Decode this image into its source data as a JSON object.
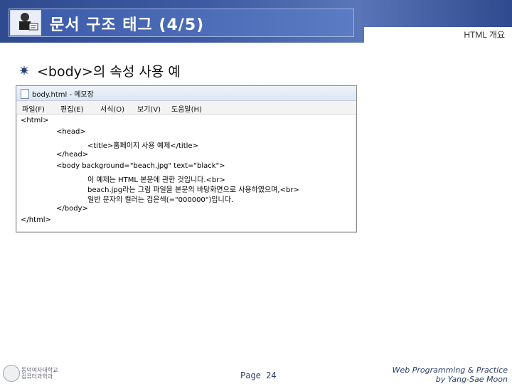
{
  "header": {
    "title": "문서 구조 태그 (4/5)",
    "section_label": "HTML 개요"
  },
  "bullet": {
    "text": "<body>의 속성 사용 예"
  },
  "notepad": {
    "window_title": "body.html - 메모장",
    "menu": [
      "파일(F)",
      "편집(E)",
      "서식(O)",
      "보기(V)",
      "도움말(H)"
    ],
    "lines": [
      "<html>",
      "<head>",
      "<title>홈페이지 사용 예제</title>",
      "</head>",
      "<body background=\"beach.jpg\" text=\"black\">",
      "이 예제는 HTML 본문에 관한 것입니다.<br>",
      "beach.jpg라는 그림 파일을 본문의 바탕화면으로 사용하였으며,<br>",
      "일반 문자의 컬러는 검은색(=\"000000\")입니다.",
      "</body>",
      "</html>"
    ]
  },
  "footer": {
    "logo_text_1": "동덕여자대학교",
    "logo_text_2": "컴퓨터과학과",
    "page": "Page 24",
    "credit_1": "Web Programming & Practice",
    "credit_2": "by Yang-Sae Moon"
  }
}
